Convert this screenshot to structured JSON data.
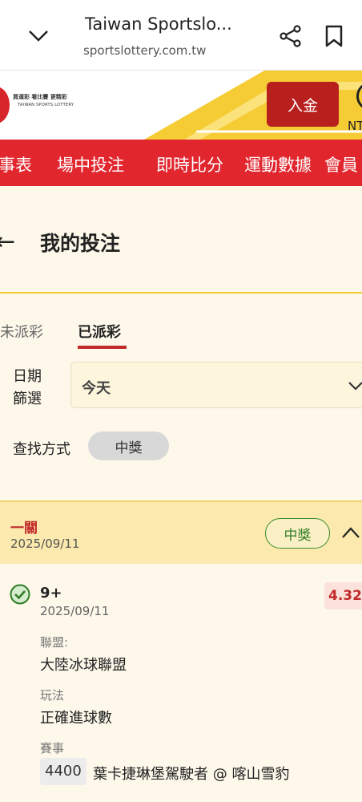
{
  "browser": {
    "title": "Taiwan Sportslo...",
    "url": "sportslottery.com.tw"
  },
  "header": {
    "logo_line1": "買運彩 看比賽 更精彩",
    "logo_line2": "TAIWAN SPORTS LOTTERY",
    "deposit_label": "入金",
    "currency_prefix": "NT"
  },
  "nav": {
    "items": [
      "事表",
      "場中投注",
      "即時比分",
      "運動數據",
      "會員"
    ]
  },
  "page": {
    "title": "我的投注",
    "tabs": [
      {
        "label": "未派彩",
        "active": false
      },
      {
        "label": "已派彩",
        "active": true
      }
    ],
    "date_filter_label": "日期\n篩選",
    "date_filter_line1": "日期",
    "date_filter_line2": "篩選",
    "date_filter_value": "今天",
    "find_label": "查找方式",
    "find_value": "中獎"
  },
  "ticket": {
    "type": "一關",
    "date": "2025/09/11",
    "status": "中獎",
    "selection": {
      "name": "9+",
      "date": "2025/09/11",
      "odds": "4.32",
      "league_label": "聯盟:",
      "league": "大陸冰球聯盟",
      "play_label": "玩法",
      "play": "正確進球數",
      "event_label": "賽事",
      "event_code": "4400",
      "event_name": "葉卡捷琳堡駕駛者 @ 喀山雪豹"
    }
  },
  "colors": {
    "brand_red": "#e1262e",
    "deposit_red": "#b8201e",
    "accent_yellow": "#f5cc34",
    "page_bg": "#fdf8ea",
    "win_green": "#2f7d25"
  }
}
